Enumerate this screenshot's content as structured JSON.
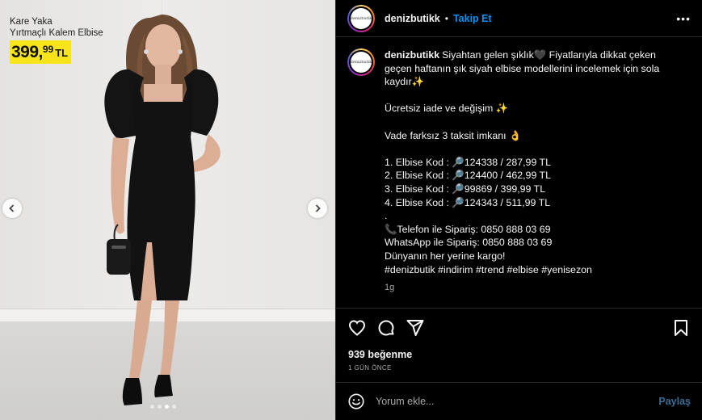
{
  "promo": {
    "line1": "Kare Yaka",
    "line2": "Yırtmaçlı Kalem Elbise",
    "price_int": "399,",
    "price_dec": "99",
    "price_cur": "TL"
  },
  "carousel": {
    "dots": 4,
    "active_index": 2
  },
  "header": {
    "username": "denizbutikk",
    "separator": "•",
    "follow_label": "Takip Et",
    "more_label": "•••",
    "avatar_text": "denizbutik"
  },
  "caption": {
    "username": "denizbutikk",
    "intro": "Siyahtan gelen şıklık🖤 Fiyatlarıyla dikkat çeken geçen haftanın şık siyah elbise modellerini incelemek için sola kaydır✨",
    "return_line": "Ücretsiz iade ve değişim ✨",
    "installment_line": "Vade farksız 3 taksit imkanı 👌",
    "items": [
      "1. Elbise Kod : 🔎124338 / 287,99 TL",
      "2. Elbise Kod : 🔎124400 / 462,99 TL",
      "3. Elbise Kod : 🔎99869 / 399,99 TL",
      "4. Elbise Kod : 🔎124343 / 511,99 TL"
    ],
    "dot_line": ".",
    "phone_line": "📞Telefon ile Sipariş: 0850 888 03 69",
    "whatsapp_line": "WhatsApp ile Sipariş: 0850 888 03 69",
    "cargo_line": "Dünyanın her yerine kargo!",
    "hashtags": "#denizbutik #indirim #trend #elbise #yenisezon",
    "time": "1g"
  },
  "actions": {
    "like_icon": "heart-icon",
    "comment_icon": "comment-icon",
    "share_icon": "send-icon",
    "save_icon": "bookmark-icon"
  },
  "likes_text": "939 beğenme",
  "date_text": "1 GÜN ÖNCE",
  "comment_box": {
    "placeholder": "Yorum ekle...",
    "post_label": "Paylaş"
  },
  "colors": {
    "accent": "#0095f6",
    "price_bg": "#f7e41a",
    "background": "#000000"
  }
}
